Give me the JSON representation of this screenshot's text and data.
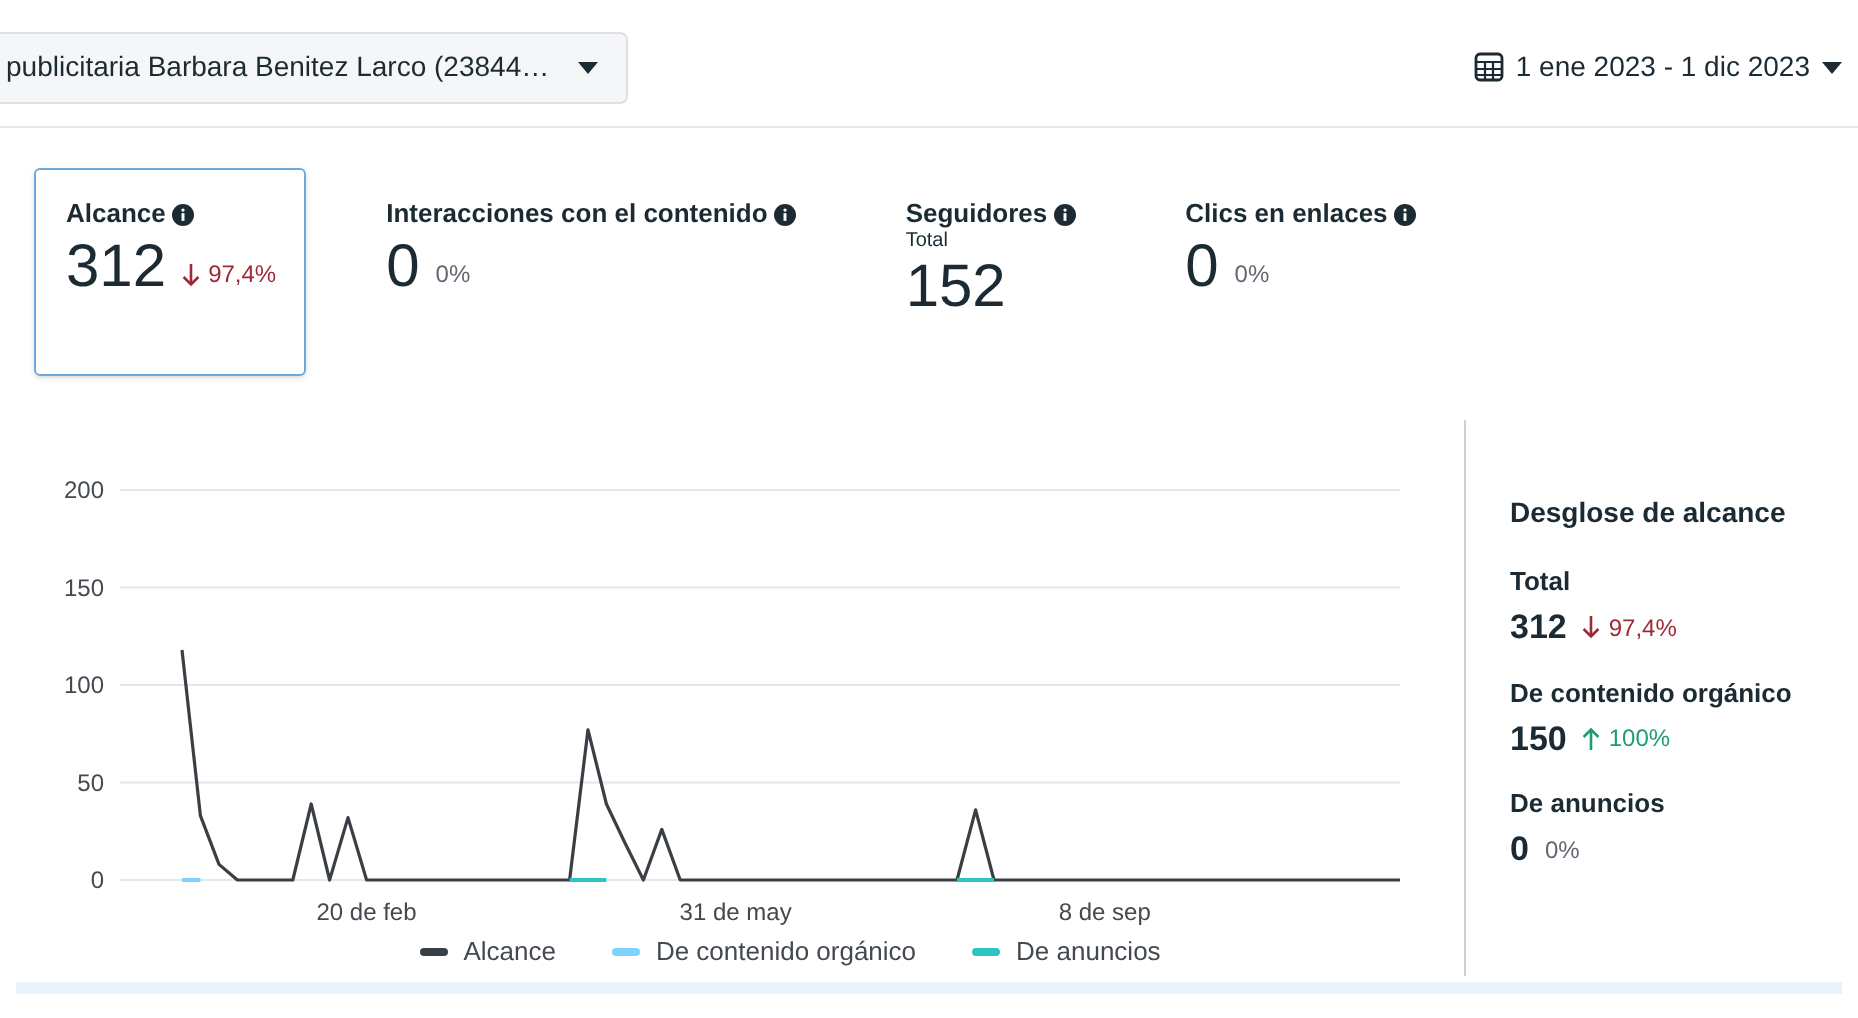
{
  "account_selector": {
    "value": "publicitaria Barbara Benitez Larco (23844…"
  },
  "date_range": {
    "value": "1 ene 2023 - 1 dic 2023"
  },
  "metrics": [
    {
      "title": "Alcance",
      "value": "312",
      "change": "97,4%",
      "kind": "down",
      "selected": true
    },
    {
      "title": "Interacciones con el contenido",
      "value": "0",
      "change": "0%",
      "kind": "flat",
      "selected": false
    },
    {
      "title": "Seguidores",
      "subtitle": "Total",
      "value": "152",
      "selected": false
    },
    {
      "title": "Clics en enlaces",
      "value": "0",
      "change": "0%",
      "kind": "flat",
      "selected": false
    }
  ],
  "chart": {
    "chart_data": {
      "type": "line",
      "categories": [
        null,
        null,
        null,
        null,
        null,
        null,
        null,
        null,
        null,
        null,
        "20 de feb",
        null,
        null,
        null,
        null,
        null,
        null,
        null,
        null,
        null,
        null,
        null,
        null,
        null,
        null,
        null,
        null,
        null,
        null,
        null,
        "31 de may",
        null,
        null,
        null,
        null,
        null,
        null,
        null,
        null,
        null,
        null,
        null,
        null,
        null,
        null,
        null,
        null,
        null,
        null,
        null,
        "8 de sep",
        null,
        null,
        null,
        null,
        null,
        null,
        null,
        null,
        null,
        null,
        null,
        null,
        null,
        null,
        null,
        null
      ],
      "series": [
        {
          "name": "Alcance",
          "color": "#3a3f45",
          "values": [
            118,
            33,
            8,
            0,
            0,
            0,
            0,
            39,
            0,
            32,
            0,
            0,
            0,
            0,
            0,
            0,
            0,
            0,
            0,
            0,
            0,
            0,
            77,
            39,
            19,
            0,
            26,
            0,
            0,
            0,
            0,
            0,
            0,
            0,
            0,
            0,
            0,
            0,
            0,
            0,
            0,
            0,
            0,
            36,
            0,
            0,
            0,
            0,
            0,
            0,
            0,
            0,
            0,
            0,
            0,
            0,
            0,
            0,
            0,
            0,
            0,
            0,
            0,
            0,
            0,
            0,
            0
          ]
        },
        {
          "name": "De contenido orgánico",
          "color": "#7dd3fc",
          "values": [
            0,
            0,
            null,
            null,
            null,
            null,
            null,
            null,
            null,
            null,
            null,
            null,
            null,
            null,
            null,
            null,
            null,
            null,
            null,
            null,
            null,
            null,
            null,
            null,
            null,
            null,
            null,
            null,
            null,
            null,
            null,
            null,
            null,
            null,
            null,
            null,
            null,
            null,
            null,
            null,
            null,
            null,
            null,
            null,
            null,
            null,
            null,
            null,
            null,
            null,
            null,
            null,
            null,
            null,
            null,
            null,
            null,
            null,
            null,
            null,
            null,
            null,
            null,
            null,
            null,
            null,
            null
          ]
        },
        {
          "name": "De anuncios",
          "color": "#2ec4c4",
          "values": [
            null,
            null,
            null,
            null,
            null,
            null,
            null,
            null,
            null,
            null,
            null,
            null,
            null,
            null,
            null,
            null,
            null,
            null,
            null,
            null,
            null,
            0,
            0,
            0,
            null,
            null,
            null,
            null,
            null,
            null,
            null,
            null,
            null,
            null,
            null,
            null,
            null,
            null,
            null,
            null,
            null,
            null,
            0,
            0,
            0,
            null,
            null,
            null,
            null,
            null,
            null,
            null,
            null,
            null,
            null,
            null,
            null,
            null,
            null,
            null,
            null,
            null,
            null,
            null,
            null,
            null,
            null
          ]
        }
      ],
      "grid": true,
      "ylim": [
        0,
        200
      ],
      "yticks": [
        0,
        50,
        100,
        150,
        200
      ]
    }
  },
  "breakdown": {
    "title": "Desglose de alcance",
    "items": [
      {
        "label": "Total",
        "value": "312",
        "change": "97,4%",
        "kind": "down"
      },
      {
        "label": "De contenido orgánico",
        "value": "150",
        "change": "100%",
        "kind": "up"
      },
      {
        "label": "De anuncios",
        "value": "0",
        "change": "0%",
        "kind": "flat"
      }
    ]
  }
}
